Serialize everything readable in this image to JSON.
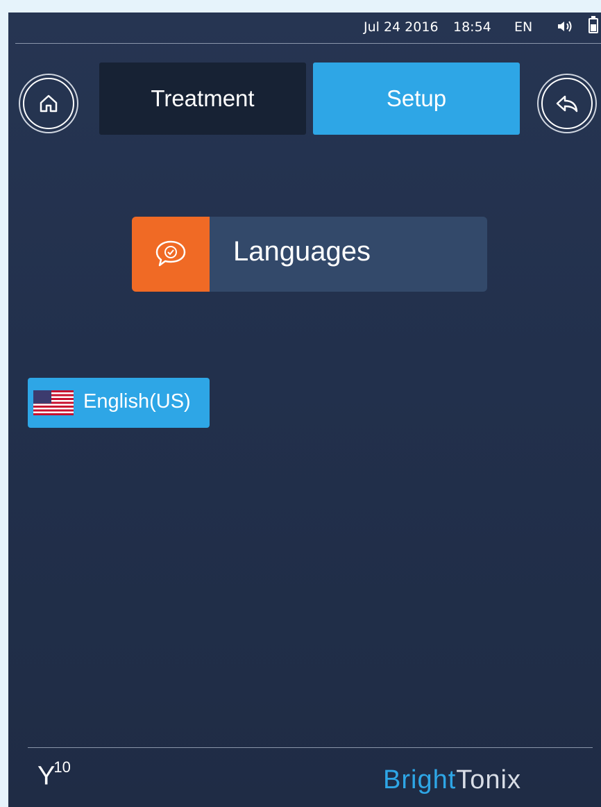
{
  "status_bar": {
    "date": "Jul 24 2016",
    "time": "18:54",
    "language": "EN",
    "volume_icon": "speaker-icon",
    "battery_icon": "battery-icon"
  },
  "nav": {
    "home_icon": "home-icon",
    "back_icon": "back-arrow-icon",
    "tabs": [
      {
        "label": "Treatment",
        "active": false
      },
      {
        "label": "Setup",
        "active": true
      }
    ]
  },
  "section": {
    "title": "Languages",
    "icon": "speech-bubble-check-icon",
    "icon_color": "#f06a25"
  },
  "languages": [
    {
      "label": "English(US)",
      "flag": "us-flag-icon",
      "selected": true
    }
  ],
  "footer": {
    "model": "Y",
    "model_sup": "10",
    "brand_part1": "Bright",
    "brand_part2": "Tonix"
  },
  "colors": {
    "accent": "#2ea6e6",
    "background": "#22304c",
    "orange": "#f06a25"
  }
}
